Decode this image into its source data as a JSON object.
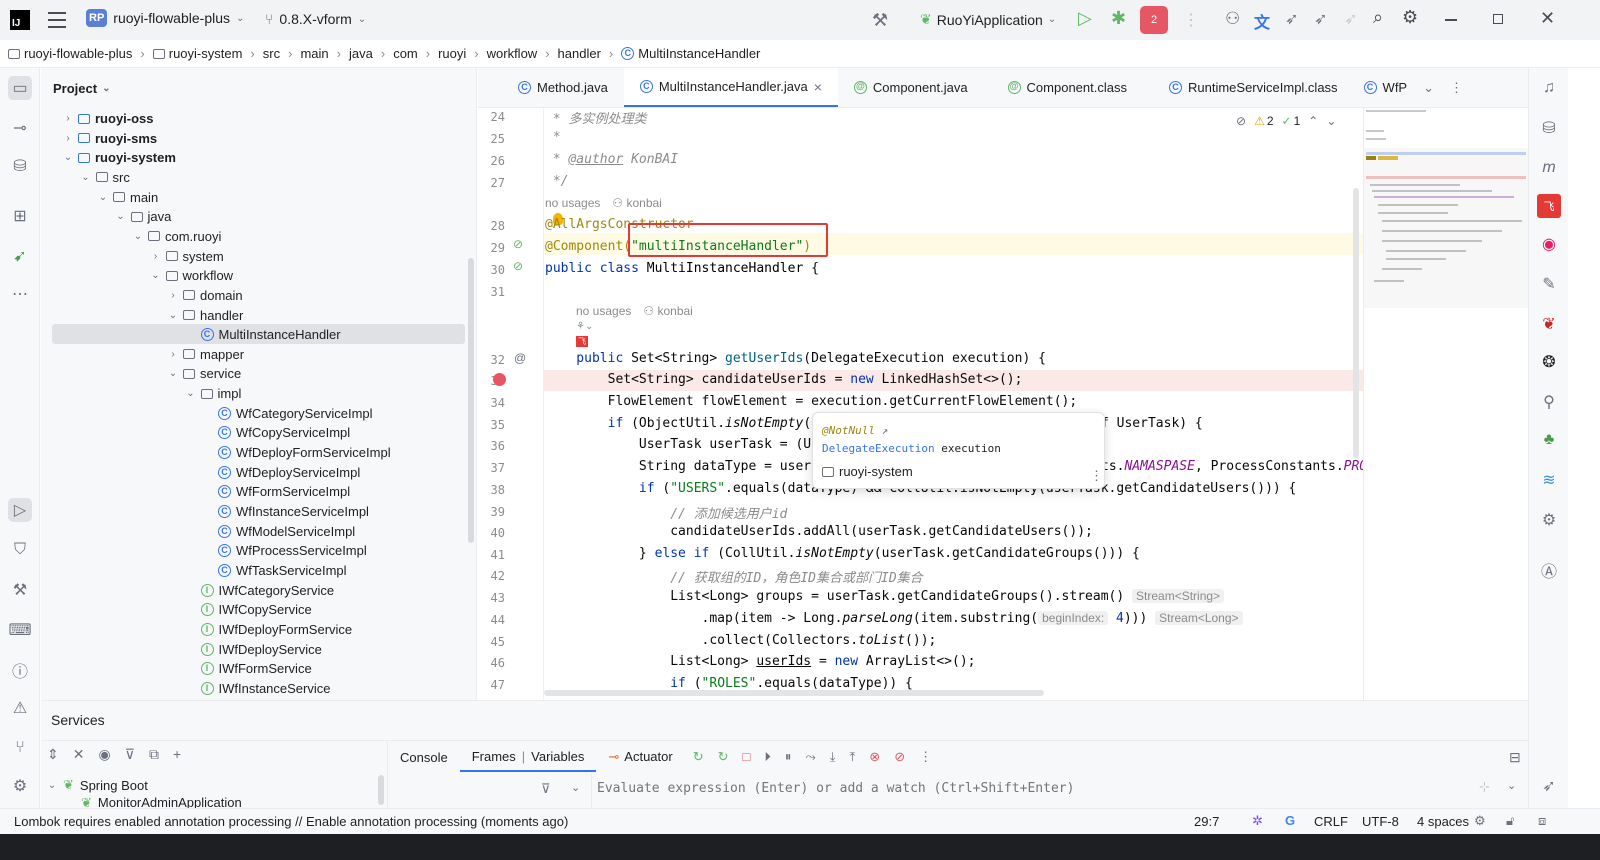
{
  "titlebar": {
    "logo": "IJ",
    "project_badge": "RP",
    "project_name": "ruoyi-flowable-plus",
    "branch": "0.8.X-vform",
    "run_config": "RuoYiApplication",
    "notif_count": "2",
    "brand_color": "#3574f0"
  },
  "breadcrumbs": [
    "ruoyi-flowable-plus",
    "ruoyi-system",
    "src",
    "main",
    "java",
    "com",
    "ruoyi",
    "workflow",
    "handler",
    "MultiInstanceHandler"
  ],
  "project": {
    "title": "Project",
    "tree": [
      {
        "label": "ruoyi-oss",
        "type": "module",
        "depth": 1,
        "arrow": "›"
      },
      {
        "label": "ruoyi-sms",
        "type": "module",
        "depth": 1,
        "arrow": "›"
      },
      {
        "label": "ruoyi-system",
        "type": "module",
        "depth": 1,
        "arrow": "⌄"
      },
      {
        "label": "src",
        "type": "folder",
        "depth": 2,
        "arrow": "⌄"
      },
      {
        "label": "main",
        "type": "folder",
        "depth": 3,
        "arrow": "⌄"
      },
      {
        "label": "java",
        "type": "folder",
        "depth": 4,
        "arrow": "⌄"
      },
      {
        "label": "com.ruoyi",
        "type": "package",
        "depth": 5,
        "arrow": "⌄"
      },
      {
        "label": "system",
        "type": "package",
        "depth": 6,
        "arrow": "›"
      },
      {
        "label": "workflow",
        "type": "package",
        "depth": 6,
        "arrow": "⌄"
      },
      {
        "label": "domain",
        "type": "package",
        "depth": 7,
        "arrow": "›"
      },
      {
        "label": "handler",
        "type": "package",
        "depth": 7,
        "arrow": "⌄"
      },
      {
        "label": "MultiInstanceHandler",
        "type": "class",
        "depth": 8,
        "arrow": "",
        "selected": true
      },
      {
        "label": "mapper",
        "type": "package",
        "depth": 7,
        "arrow": "›"
      },
      {
        "label": "service",
        "type": "package",
        "depth": 7,
        "arrow": "⌄"
      },
      {
        "label": "impl",
        "type": "package",
        "depth": 8,
        "arrow": "⌄"
      },
      {
        "label": "WfCategoryServiceImpl",
        "type": "class",
        "depth": 9,
        "arrow": ""
      },
      {
        "label": "WfCopyServiceImpl",
        "type": "class",
        "depth": 9,
        "arrow": ""
      },
      {
        "label": "WfDeployFormServiceImpl",
        "type": "class",
        "depth": 9,
        "arrow": ""
      },
      {
        "label": "WfDeployServiceImpl",
        "type": "class",
        "depth": 9,
        "arrow": ""
      },
      {
        "label": "WfFormServiceImpl",
        "type": "class",
        "depth": 9,
        "arrow": ""
      },
      {
        "label": "WfInstanceServiceImpl",
        "type": "class",
        "depth": 9,
        "arrow": ""
      },
      {
        "label": "WfModelServiceImpl",
        "type": "class",
        "depth": 9,
        "arrow": ""
      },
      {
        "label": "WfProcessServiceImpl",
        "type": "class",
        "depth": 9,
        "arrow": ""
      },
      {
        "label": "WfTaskServiceImpl",
        "type": "class",
        "depth": 9,
        "arrow": ""
      },
      {
        "label": "IWfCategoryService",
        "type": "interface",
        "depth": 8,
        "arrow": ""
      },
      {
        "label": "IWfCopyService",
        "type": "interface",
        "depth": 8,
        "arrow": ""
      },
      {
        "label": "IWfDeployFormService",
        "type": "interface",
        "depth": 8,
        "arrow": ""
      },
      {
        "label": "IWfDeployService",
        "type": "interface",
        "depth": 8,
        "arrow": ""
      },
      {
        "label": "IWfFormService",
        "type": "interface",
        "depth": 8,
        "arrow": ""
      },
      {
        "label": "IWfInstanceService",
        "type": "interface",
        "depth": 8,
        "arrow": ""
      }
    ]
  },
  "tabs": [
    {
      "label": "Method.java",
      "icon": "class-icon"
    },
    {
      "label": "MultiInstanceHandler.java",
      "icon": "class-icon",
      "active": true,
      "close": "×"
    },
    {
      "label": "Component.java",
      "icon": "annotation-icon"
    },
    {
      "label": "Component.class",
      "icon": "annotation-icon"
    },
    {
      "label": "RuntimeServiceImpl.class",
      "icon": "class-icon"
    },
    {
      "label": "WfP",
      "icon": "class-icon"
    }
  ],
  "inspections": {
    "warnings": "2",
    "ok": "1"
  },
  "editor": {
    "line_numbers": [
      "24",
      "25",
      "26",
      "27",
      "28",
      "29",
      "30",
      "31",
      "32",
      "33",
      "34",
      "35",
      "36",
      "37",
      "38",
      "39",
      "40",
      "41",
      "42",
      "43",
      "44",
      "45",
      "46",
      "47"
    ],
    "c24": " * 多实例处理类",
    "c25": " *",
    "c26_a": " * ",
    "c26_tag": "@author",
    "c26_b": " KonBAI",
    "c27": " */",
    "usages1": "no usages",
    "author1": "konbai",
    "l28": "@AllArgsConstructor",
    "l29_ann": "@Component(",
    "l29_str": "\"multiInstanceHandler\"",
    "l29_end": ")",
    "l30_kw": "public class ",
    "l30_name": "MultiInstanceHandler",
    "l30_end": " {",
    "usages2": "no usages",
    "author2": "konbai",
    "l32_kw": "    public ",
    "l32_type": "Set<String> ",
    "l32_fn": "getUserIds",
    "l32_rest": "(DelegateExecution execution) {",
    "l33_a": "        Set<String> candidateUserIds = ",
    "l33_kw": "new",
    "l33_b": " LinkedHashSet<>();",
    "l34": "        FlowElement flowElement = execution.getCurrentFlowElement();",
    "l35_kw": "        if",
    "l35_a": " (ObjectUtil.",
    "l35_st": "isNotEmpty",
    "l35_b": "(",
    "l35_tail": "f UserTask) {",
    "l36": "            UserTask userTask = (U",
    "l37_a": "            String dataType = user",
    "l37_tail_a": "ts.",
    "l37_const": "NAMASPASE",
    "l37_tail_b": ", ProcessConstants.",
    "l37_const2": "PRO",
    "l38_kw": "            if",
    "l38_a": " (",
    "l38_str": "\"USERS\"",
    "l38_b": ".equals(dataType) && CollUtil.isNotEmpty(userTask.getCandidateUsers())) {",
    "l39": "                // 添加候选用户id",
    "l40": "                candidateUserIds.addAll(userTask.getCandidateUsers());",
    "l41_a": "            } ",
    "l41_kw": "else if",
    "l41_b": " (CollUtil.",
    "l41_st": "isNotEmpty",
    "l41_c": "(userTask.getCandidateGroups())) {",
    "l42": "                // 获取组的ID，角色ID集合或部门ID集合",
    "l43": "                List<Long> groups = userTask.getCandidateGroups().stream()",
    "l43_hint": "Stream<String>",
    "l44_a": "                    .map(item -> Long.",
    "l44_st": "parseLong",
    "l44_b": "(item.substring(",
    "l44_param": "beginIndex:",
    "l44_num": " 4",
    "l44_c": ")))",
    "l44_hint": "Stream<Long>",
    "l45_a": "                    .collect(Collectors.",
    "l45_st": "toList",
    "l45_b": "());",
    "l46_a": "                List<Long> ",
    "l46_var": "userIds",
    "l46_b": " = ",
    "l46_kw": "new",
    "l46_c": " ArrayList<>();",
    "l47_kw": "                if",
    "l47_a": " (",
    "l47_str": "\"ROLES\"",
    "l47_b": ".equals(dataType)) {"
  },
  "popup": {
    "annotation": "@NotNull",
    "arrow": "↗",
    "type": "DelegateExecution",
    "param": "execution",
    "module": "ruoyi-system",
    "more": "⋮"
  },
  "services": {
    "title": "Services",
    "tree_root": "Spring Boot",
    "tree_child": "MonitorAdminApplication",
    "tab_console": "Console",
    "tab_frames": "Frames",
    "tab_variables": "Variables",
    "tab_actuator": "Actuator",
    "eval_placeholder": "Evaluate expression (Enter) or add a watch (Ctrl+Shift+Enter)"
  },
  "status": {
    "message": "Lombok requires enabled annotation processing // Enable annotation processing (moments ago)",
    "position": "29:7",
    "line_sep": "CRLF",
    "encoding": "UTF-8",
    "indent": "4 spaces"
  },
  "colors": {
    "highlight_box": "#e53935",
    "breakpoint_line": "#fbe9e7",
    "current_line": "#fffae3"
  }
}
